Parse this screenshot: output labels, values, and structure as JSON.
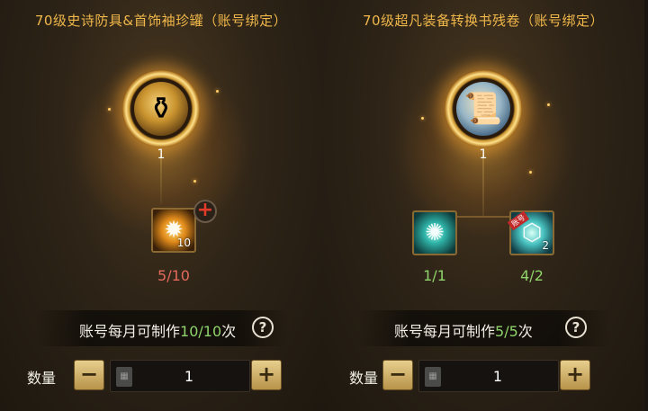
{
  "panels": [
    {
      "title": "70级史诗防具&首饰袖珍罐（账号绑定）",
      "main_item": {
        "icon": "jar-icon",
        "count": "1"
      },
      "materials": [
        {
          "icon": "sun-emblem-icon",
          "stack": "10",
          "requirement": "5/10",
          "status_color": "#e36a5c"
        }
      ],
      "add_badge": "+",
      "limit": {
        "prefix": "账号每月可制作",
        "value": "10/10",
        "suffix": "次"
      },
      "help": "?",
      "quantity": {
        "label": "数量",
        "minus": "−",
        "plus": "+",
        "value": "1"
      }
    },
    {
      "title": "70级超凡装备转换书残卷（账号绑定）",
      "main_item": {
        "icon": "scroll-icon",
        "count": "1"
      },
      "materials": [
        {
          "icon": "teal-emblem-icon",
          "stack": "",
          "requirement": "1/1",
          "status_color": "#8fd46a"
        },
        {
          "icon": "crystal-icon",
          "stack": "2",
          "ribbon": "账号",
          "requirement": "4/2",
          "status_color": "#8fd46a"
        }
      ],
      "limit": {
        "prefix": "账号每月可制作",
        "value": "5/5",
        "suffix": "次"
      },
      "help": "?",
      "quantity": {
        "label": "数量",
        "minus": "−",
        "plus": "+",
        "value": "1"
      }
    }
  ],
  "colors": {
    "title": "#f0b74a",
    "accent_green": "#8fd46a",
    "accent_red": "#e36a5c"
  }
}
